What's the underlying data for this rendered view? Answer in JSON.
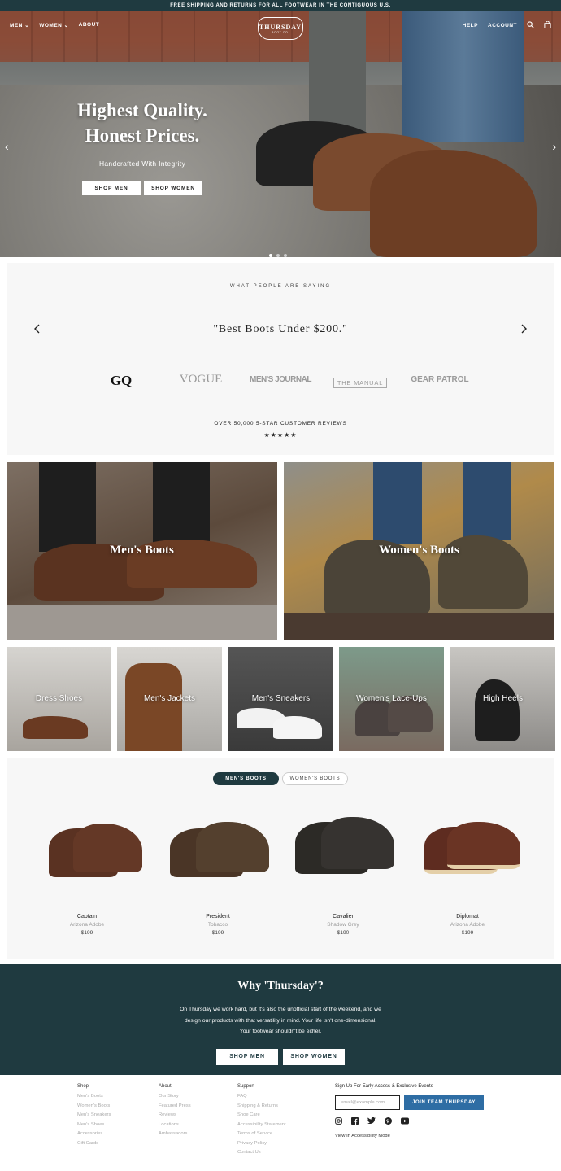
{
  "promo": "FREE SHIPPING AND RETURNS FOR ALL FOOTWEAR IN THE CONTIGUOUS U.S.",
  "nav": {
    "men": "MEN",
    "women": "WOMEN",
    "about": "ABOUT",
    "help": "HELP",
    "account": "ACCOUNT",
    "logo_main": "THURSDAY",
    "logo_sub": "BOOT CO."
  },
  "hero": {
    "line1": "Highest Quality.",
    "line2": "Honest Prices.",
    "sub": "Handcrafted With Integrity",
    "btn_men": "SHOP MEN",
    "btn_women": "SHOP WOMEN"
  },
  "press": {
    "label": "WHAT PEOPLE ARE SAYING",
    "quote": "\"Best Boots Under $200.\"",
    "logos": [
      "GQ",
      "VOGUE",
      "MEN'S JOURNAL",
      "THE MANUAL",
      "GEAR PATROL"
    ],
    "reviews": "OVER 50,000 5-STAR CUSTOMER REVIEWS",
    "stars": "★★★★★"
  },
  "categories": {
    "big": [
      "Men's Boots",
      "Women's Boots"
    ],
    "small": [
      "Dress Shoes",
      "Men's Jackets",
      "Men's Sneakers",
      "Women's Lace-Ups",
      "High Heels"
    ]
  },
  "products": {
    "tabs": [
      "MEN'S BOOTS",
      "WOMEN'S BOOTS"
    ],
    "items": [
      {
        "name": "Captain",
        "color": "Arizona Adobe",
        "price": "$199"
      },
      {
        "name": "President",
        "color": "Tobacco",
        "price": "$199"
      },
      {
        "name": "Cavalier",
        "color": "Shadow Grey",
        "price": "$190"
      },
      {
        "name": "Diplomat",
        "color": "Arizona Adobe",
        "price": "$199"
      }
    ]
  },
  "why": {
    "title": "Why 'Thursday'?",
    "body": "On Thursday we work hard, but it's also the unofficial start of the weekend, and we design our products with that versatility in mind. Your life isn't one-dimensional. Your footwear shouldn't be either.",
    "btn_men": "SHOP MEN",
    "btn_women": "SHOP WOMEN"
  },
  "footer": {
    "shop": {
      "title": "Shop",
      "links": [
        "Men's Boots",
        "Women's Boots",
        "Men's Sneakers",
        "Men's Shoes",
        "Accessories",
        "Gift Cards"
      ]
    },
    "about": {
      "title": "About",
      "links": [
        "Our Story",
        "Featured Press",
        "Reviews",
        "Locations",
        "Ambassadors"
      ]
    },
    "support": {
      "title": "Support",
      "links": [
        "FAQ",
        "Shipping & Returns",
        "Shoe Care",
        "Accessibility Statement",
        "Terms of Service",
        "Privacy Policy",
        "Contact Us"
      ]
    },
    "signup_title": "Sign Up For Early Access & Exclusive Events",
    "email_placeholder": "email@example.com",
    "join": "JOIN TEAM THURSDAY",
    "accessibility": "View In Accessibility Mode"
  }
}
